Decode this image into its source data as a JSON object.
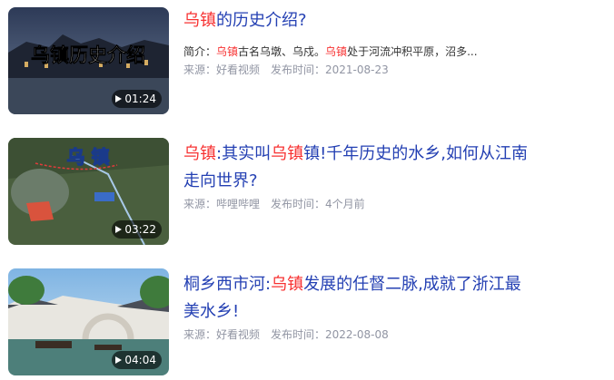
{
  "results": [
    {
      "title_parts": [
        {
          "text": "乌镇",
          "hl": true
        },
        {
          "text": "的历史介绍?",
          "hl": false
        }
      ],
      "desc_parts": [
        {
          "text": "简介：",
          "hl": false
        },
        {
          "text": "乌镇",
          "hl": true
        },
        {
          "text": "古名乌墩、乌戍。",
          "hl": false
        },
        {
          "text": "乌镇",
          "hl": true
        },
        {
          "text": "处于河流冲积平原，沼多...",
          "hl": false
        }
      ],
      "source": "来源：好看视频",
      "publish": "发布时间：2021-08-23",
      "duration": "01:24",
      "thumb_caption": "乌镇历史介绍"
    },
    {
      "title_parts": [
        {
          "text": "乌镇",
          "hl": true
        },
        {
          "text": ":其实叫",
          "hl": false
        },
        {
          "text": "乌镇",
          "hl": true
        },
        {
          "text": "镇!千年历史的水乡,如何从江南走向世界?",
          "hl": false
        }
      ],
      "source": "来源：哔哩哔哩",
      "publish": "发布时间：4个月前",
      "duration": "03:22",
      "thumb_caption": "乌 镇"
    },
    {
      "title_parts": [
        {
          "text": "桐乡西市河:",
          "hl": false
        },
        {
          "text": "乌镇",
          "hl": true
        },
        {
          "text": "发展的任督二脉,成就了浙江最美水乡!",
          "hl": false
        }
      ],
      "source": "来源：好看视频",
      "publish": "发布时间：2022-08-08",
      "duration": "04:04"
    }
  ],
  "colors": {
    "title": "#2440b3",
    "highlight": "#f73131",
    "meta": "#9195a3"
  },
  "icons": {
    "play": "play-icon"
  }
}
